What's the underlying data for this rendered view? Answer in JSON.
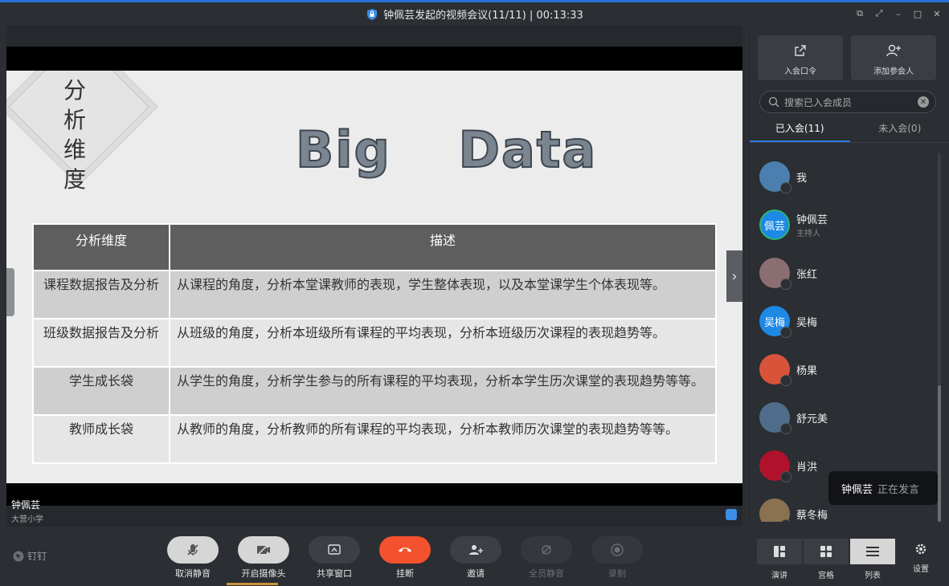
{
  "window": {
    "title": "钟佩芸发起的视频会议(11/11) | 00:13:33"
  },
  "slide": {
    "vertical_title": "分析维度",
    "big_title": "Big Data",
    "table_headers": [
      "分析维度",
      "描述"
    ],
    "rows": [
      {
        "dim": "课程数据报告及分析",
        "desc": "从课程的角度，分析本堂课教师的表现，学生整体表现，以及本堂课学生个体表现等。"
      },
      {
        "dim": "班级数据报告及分析",
        "desc": "从班级的角度，分析本班级所有课程的平均表现，分析本班级历次课程的表现趋势等。"
      },
      {
        "dim": "学生成长袋",
        "desc": "从学生的角度，分析学生参与的所有课程的平均表现，分析本学生历次课堂的表现趋势等等。"
      },
      {
        "dim": "教师成长袋",
        "desc": "从教师的角度，分析教师的所有课程的平均表现，分析本教师历次课堂的表现趋势等等。"
      }
    ]
  },
  "speaker": {
    "name": "钟佩芸",
    "org": "大营小学"
  },
  "controls": {
    "brand": "钉钉",
    "mute": "取消静音",
    "camera": "开启摄像头",
    "share": "共享窗口",
    "hangup": "挂断",
    "invite": "邀请",
    "mute_all": "全员静音",
    "record": "录制"
  },
  "panel": {
    "join_code": "入会口令",
    "add_participant": "添加参会人",
    "search_placeholder": "搜索已入会成员",
    "tab_joined": "已入会(11)",
    "tab_not_joined": "未入会(0)",
    "members": [
      {
        "name": "我",
        "role": "",
        "avatar_text": "",
        "color": "#4a7fb0"
      },
      {
        "name": "钟佩芸",
        "role": "主持人",
        "avatar_text": "佩芸",
        "color": "#1e88e5"
      },
      {
        "name": "张红",
        "role": "",
        "avatar_text": "",
        "color": "#8a6e72"
      },
      {
        "name": "吴梅",
        "role": "",
        "avatar_text": "吴梅",
        "color": "#1e88e5"
      },
      {
        "name": "杨果",
        "role": "",
        "avatar_text": "",
        "color": "#d9533a"
      },
      {
        "name": "舒元美",
        "role": "",
        "avatar_text": "",
        "color": "#4f6d8a"
      },
      {
        "name": "肖洪",
        "role": "",
        "avatar_text": "",
        "color": "#b0122b"
      },
      {
        "name": "蔡冬梅",
        "role": "",
        "avatar_text": "",
        "color": "#8a7250"
      }
    ],
    "toast": {
      "who": "钟佩芸",
      "what": "正在发言"
    }
  },
  "view": {
    "speaker": "演讲",
    "grid": "宫格",
    "list": "列表",
    "settings": "设置"
  },
  "colors": {
    "accent": "#2a7ae2",
    "hangup": "#f4512e",
    "background": "#2b2e33"
  }
}
